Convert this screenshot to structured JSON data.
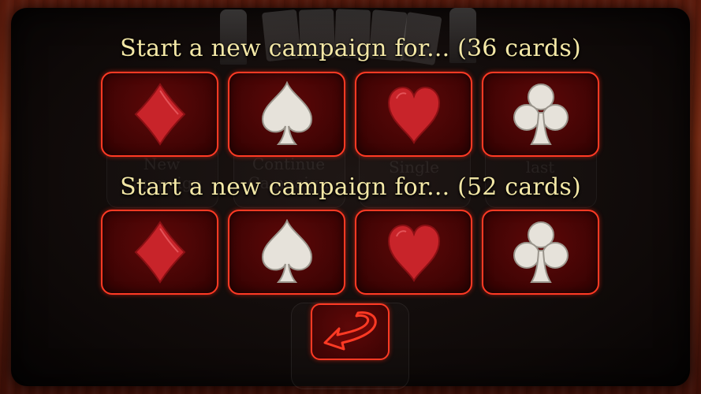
{
  "headings": {
    "cards36": "Start a new campaign for... (36 cards)",
    "cards52": "Start a new campaign for... (52 cards)"
  },
  "suit_buttons": [
    {
      "suit": "diamonds",
      "icon": "diamond-icon",
      "color": "#c8242a"
    },
    {
      "suit": "spades",
      "icon": "spade-icon",
      "color": "#e6e2da"
    },
    {
      "suit": "hearts",
      "icon": "heart-icon",
      "color": "#c8242a"
    },
    {
      "suit": "clubs",
      "icon": "club-icon",
      "color": "#e6e2da"
    }
  ],
  "background_menu": {
    "new_campaign": "New Campaign",
    "continue_campaign": "Continue Campaign",
    "single": "Single",
    "last": "last"
  },
  "back_button": {
    "icon": "undo-arrow-icon"
  },
  "colors": {
    "heading": "#f3e7a6",
    "tile_border": "#ff3a24",
    "tile_fill": "#4a0505"
  }
}
